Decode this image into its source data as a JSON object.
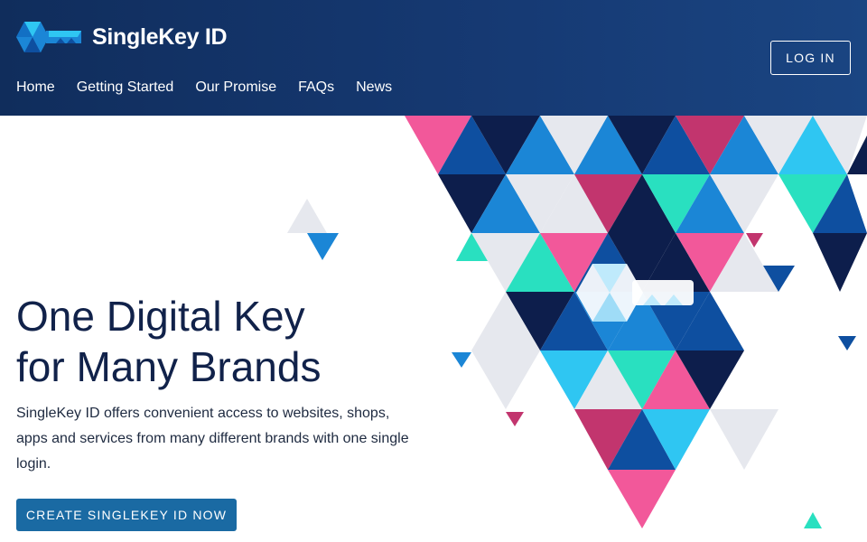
{
  "header": {
    "brand_name": "SingleKey ID",
    "logo_icon": "key-icon",
    "login_label": "LOG IN"
  },
  "nav": {
    "items": [
      {
        "label": "Home"
      },
      {
        "label": "Getting Started"
      },
      {
        "label": "Our Promise"
      },
      {
        "label": "FAQs"
      },
      {
        "label": "News"
      }
    ]
  },
  "hero": {
    "title_line1": "One Digital Key",
    "title_line2": "for Many Brands",
    "description": "SingleKey ID offers convenient access to websites, shops, apps and services from many different brands with one single login.",
    "cta_label": "CREATE SINGLEKEY ID NOW"
  },
  "colors": {
    "header_bg": "#143466",
    "cta_bg": "#1a6aa3",
    "title_text": "#11224a",
    "triangle_palette": [
      "#0d1e4c",
      "#0e4fa0",
      "#1b86d6",
      "#2fc6f2",
      "#29e0c0",
      "#f2589a",
      "#c2356e",
      "#e6e8ee"
    ]
  }
}
